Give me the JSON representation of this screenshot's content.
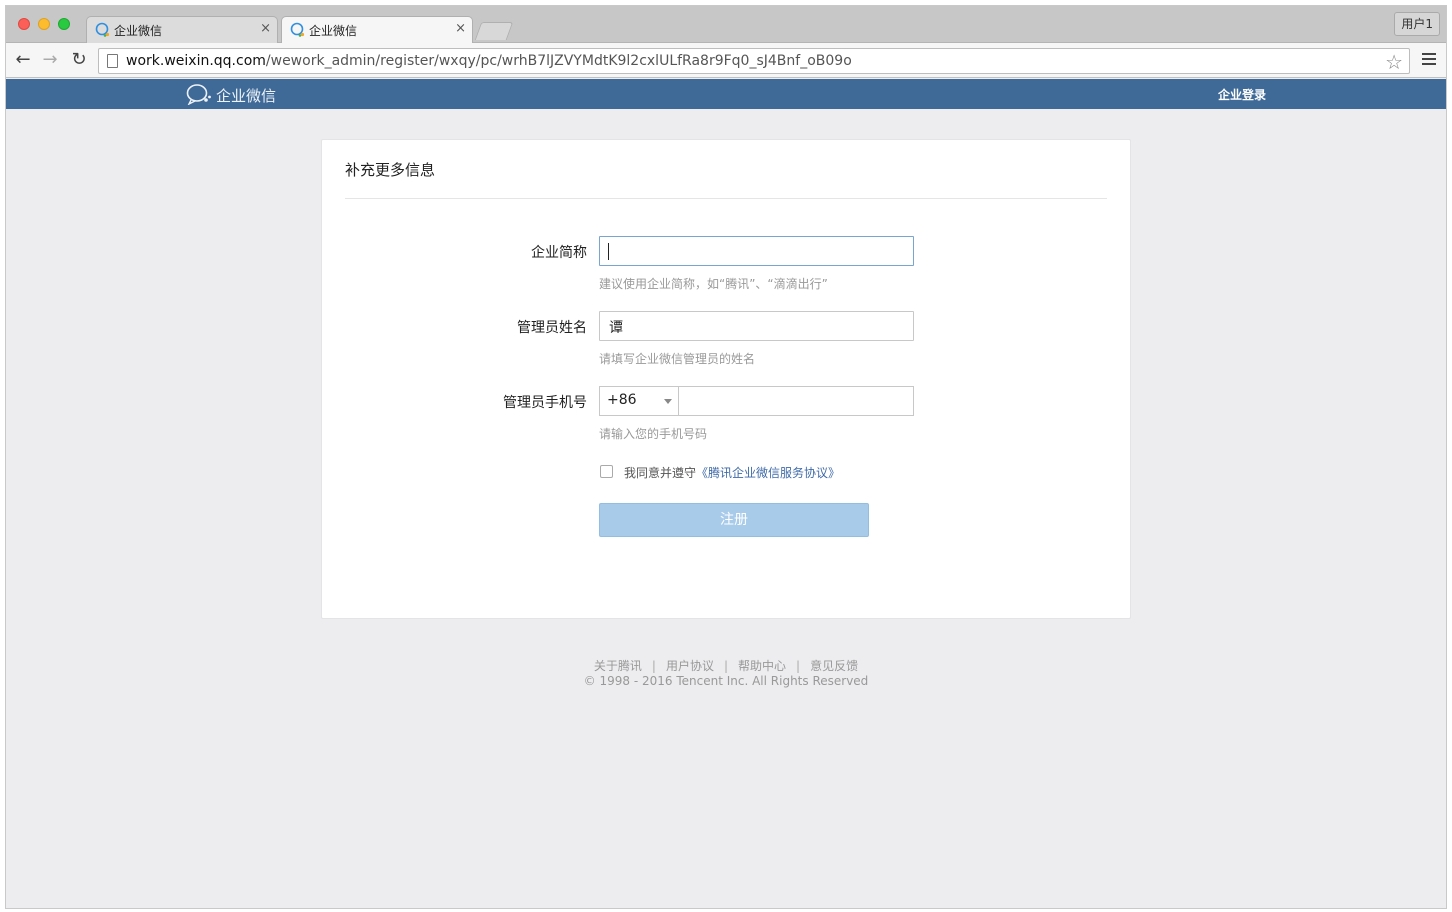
{
  "browser": {
    "tabs": [
      {
        "title": "企业微信",
        "close": "×",
        "active": false
      },
      {
        "title": "企业微信",
        "close": "×",
        "active": true
      }
    ],
    "profile_label": "用户1",
    "url_host": "work.weixin.qq.com",
    "url_path": "/wework_admin/register/wxqy/pc/wrhB7lJZVYMdtK9l2cxlULfRa8r9Fq0_sJ4Bnf_oB09o",
    "back_glyph": "←",
    "forward_glyph": "→",
    "reload_glyph": "↻",
    "star_glyph": "☆"
  },
  "site_header": {
    "brand_name": "企业微信",
    "login_link": "企业登录",
    "bar_color": "#3f6a98"
  },
  "form": {
    "title": "补充更多信息",
    "company_short_name": {
      "label": "企业简称",
      "value": "",
      "hint": "建议使用企业简称，如“腾讯”、“滴滴出行”"
    },
    "admin_name": {
      "label": "管理员姓名",
      "value": "谭",
      "hint": "请填写企业微信管理员的姓名"
    },
    "admin_phone": {
      "label": "管理员手机号",
      "country_code": "+86",
      "value": "",
      "hint": "请输入您的手机号码"
    },
    "agreement": {
      "checked": false,
      "text": "我同意并遵守",
      "link_text": "《腾讯企业微信服务协议》"
    },
    "submit_label": "注册"
  },
  "footer": {
    "links": [
      "关于腾讯",
      "用户协议",
      "帮助中心",
      "意见反馈"
    ],
    "separator": "|",
    "copyright": "© 1998 - 2016 Tencent Inc. All Rights Reserved"
  }
}
